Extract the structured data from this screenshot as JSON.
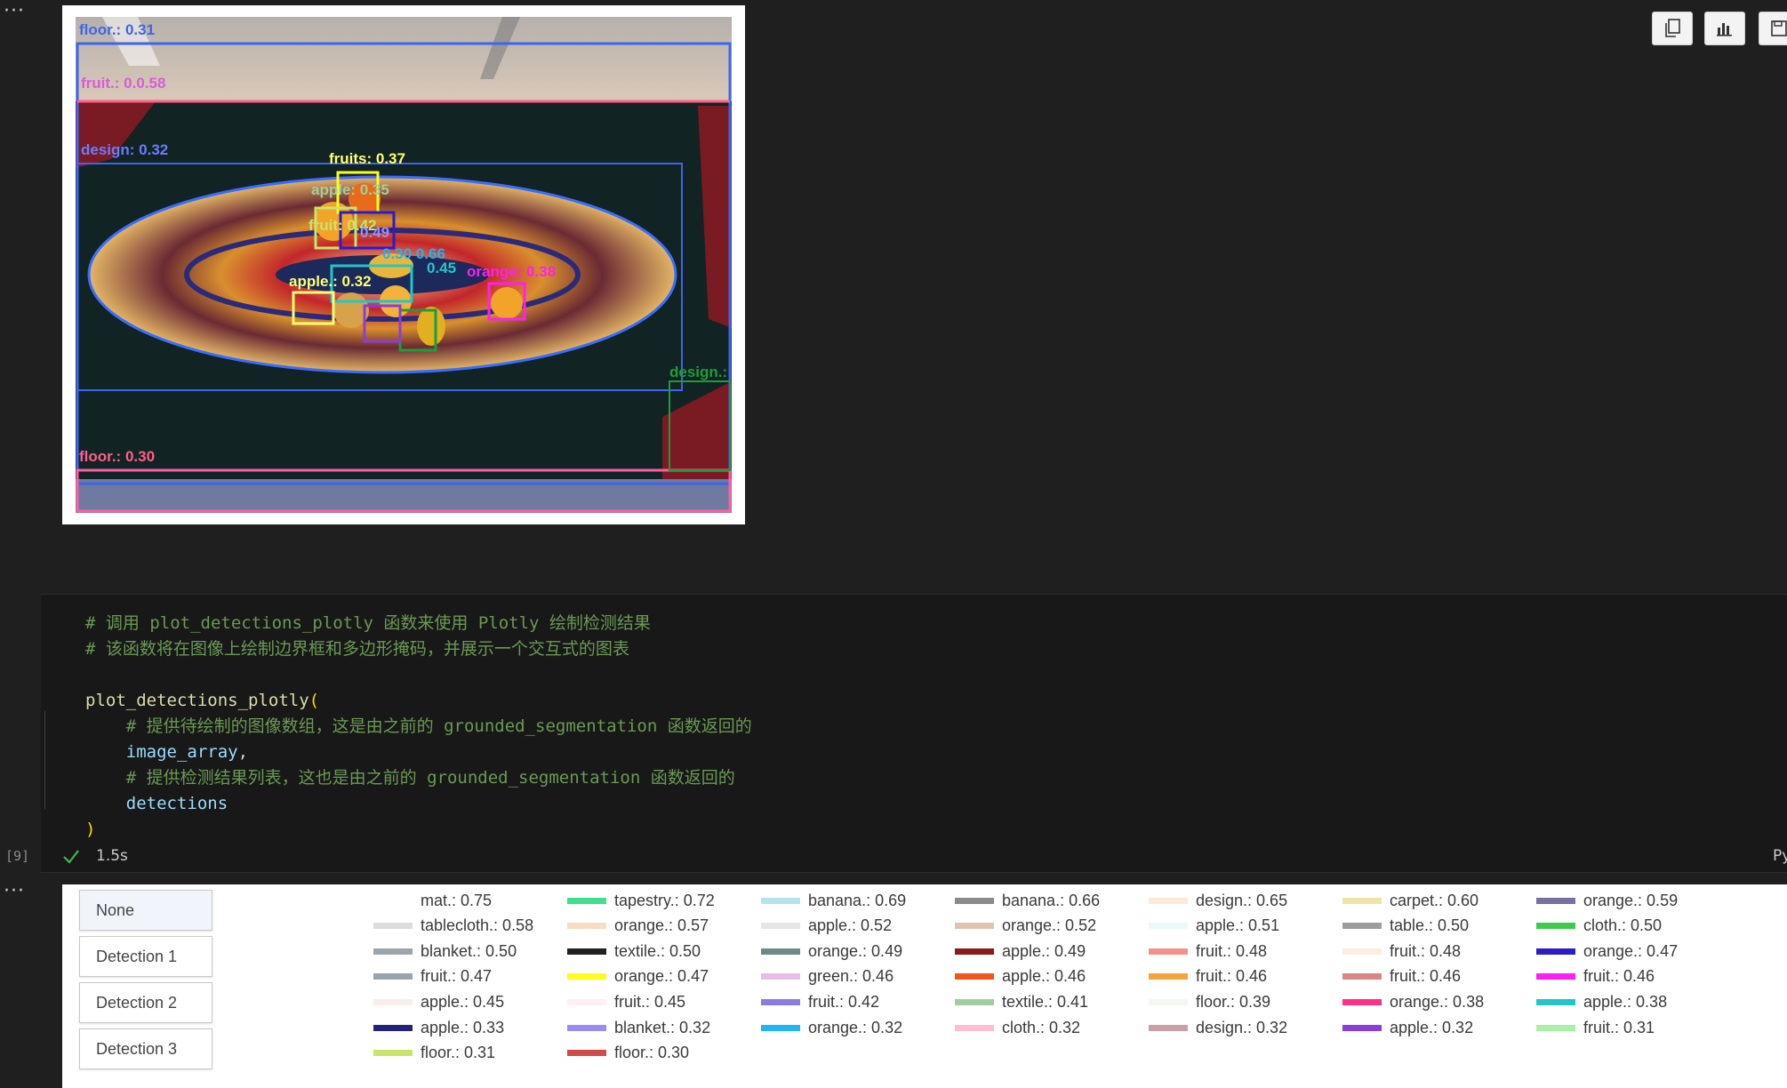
{
  "gutter": {
    "dots": "···",
    "exec_count": "[9]"
  },
  "toolbar": {
    "icons": [
      "copy-icon",
      "chart-icon",
      "save-icon"
    ]
  },
  "image": {
    "labels": [
      "floor.: 0.31",
      "fruit.: 0.0.58",
      "design: 0.32",
      "fruits: 0.37",
      "apple: 0.35",
      "fruit: 0.42",
      "0.49",
      "0.30 0.66",
      "apple.: 0.32",
      "0.45",
      "orange: 0.38",
      "design.:",
      "floor.: 0.30"
    ]
  },
  "code": {
    "comment1": "# 调用 plot_detections_plotly 函数来使用 Plotly 绘制检测结果",
    "comment2": "# 该函数将在图像上绘制边界框和多边形掩码，并展示一个交互式的图表",
    "call_name": "plot_detections_plotly",
    "open_paren": "(",
    "comment3": "# 提供待绘制的图像数组，这是由之前的 grounded_segmentation 函数返回的",
    "arg1": "image_array",
    "comma": ",",
    "comment4": "# 提供检测结果列表，这也是由之前的 grounded_segmentation 函数返回的",
    "arg2": "detections",
    "close_paren": ")"
  },
  "status": {
    "exec_time": "1.5s",
    "kernel_lang": "Py"
  },
  "plot": {
    "buttons": [
      "None",
      "Detection 1",
      "Detection 2",
      "Detection 3"
    ],
    "legend": [
      {
        "label": "mat.: 0.75",
        "color": "#ffffff"
      },
      {
        "label": "tapestry.: 0.72",
        "color": "#3ee08f"
      },
      {
        "label": "banana.: 0.69",
        "color": "#b7e3ec"
      },
      {
        "label": "banana.: 0.66",
        "color": "#8a8a8a"
      },
      {
        "label": "design.: 0.65",
        "color": "#fde9d8"
      },
      {
        "label": "carpet.: 0.60",
        "color": "#efe4a8"
      },
      {
        "label": "orange.: 0.59",
        "color": "#7a6fa0"
      },
      {
        "label": "tablecloth.: 0.58",
        "color": "#dcdcdc"
      },
      {
        "label": "orange.: 0.57",
        "color": "#f6dcc0"
      },
      {
        "label": "apple.: 0.52",
        "color": "#e6e6e6"
      },
      {
        "label": "orange.: 0.52",
        "color": "#e0c3ac"
      },
      {
        "label": "apple.: 0.51",
        "color": "#eaf8fb"
      },
      {
        "label": "table.: 0.50",
        "color": "#9d9d9d"
      },
      {
        "label": "cloth.: 0.50",
        "color": "#3ecb4c"
      },
      {
        "label": "blanket.: 0.50",
        "color": "#9ea5ab"
      },
      {
        "label": "textile.: 0.50",
        "color": "#202020"
      },
      {
        "label": "orange.: 0.49",
        "color": "#6c8a86"
      },
      {
        "label": "apple.: 0.49",
        "color": "#8b1a1a"
      },
      {
        "label": "fruit.: 0.48",
        "color": "#f2928a"
      },
      {
        "label": "fruit.: 0.48",
        "color": "#fbeede"
      },
      {
        "label": "orange.: 0.47",
        "color": "#2b1bc9"
      },
      {
        "label": "fruit.: 0.47",
        "color": "#9aa4ac"
      },
      {
        "label": "orange.: 0.47",
        "color": "#ffff1a"
      },
      {
        "label": "green.: 0.46",
        "color": "#e7bfe6"
      },
      {
        "label": "apple.: 0.46",
        "color": "#f4571c"
      },
      {
        "label": "fruit.: 0.46",
        "color": "#f7a23a"
      },
      {
        "label": "fruit.: 0.46",
        "color": "#d98686"
      },
      {
        "label": "fruit.: 0.46",
        "color": "#ff1ff2"
      },
      {
        "label": "apple.: 0.45",
        "color": "#f8efea"
      },
      {
        "label": "fruit.: 0.45",
        "color": "#fdeff4"
      },
      {
        "label": "fruit.: 0.42",
        "color": "#8e7be0"
      },
      {
        "label": "textile.: 0.41",
        "color": "#9fcf9f"
      },
      {
        "label": "floor.: 0.39",
        "color": "#f1f9ee"
      },
      {
        "label": "orange.: 0.38",
        "color": "#ff2f8a"
      },
      {
        "label": "apple.: 0.38",
        "color": "#23c6c8"
      },
      {
        "label": "apple.: 0.33",
        "color": "#23237a"
      },
      {
        "label": "blanket.: 0.32",
        "color": "#9b8cf5"
      },
      {
        "label": "orange.: 0.32",
        "color": "#1fb4f2"
      },
      {
        "label": "cloth.: 0.32",
        "color": "#fbbfd0"
      },
      {
        "label": "design.: 0.32",
        "color": "#c8a0a6"
      },
      {
        "label": "apple.: 0.32",
        "color": "#8a3dd8"
      },
      {
        "label": "fruit.: 0.31",
        "color": "#a6f0a8"
      },
      {
        "label": "floor.: 0.31",
        "color": "#c9e36c"
      },
      {
        "label": "floor.: 0.30",
        "color": "#d04a4a"
      }
    ]
  }
}
